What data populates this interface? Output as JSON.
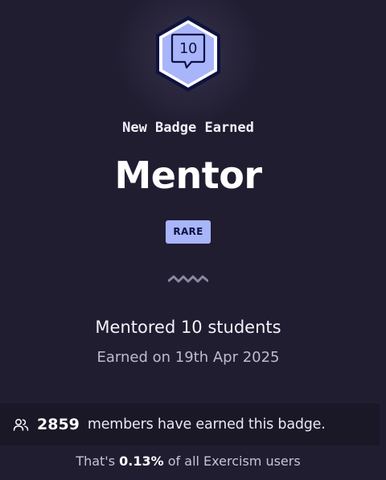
{
  "badge": {
    "name": "Mentor",
    "count_label": "10",
    "icon": "chat-bubble-icon",
    "rarity": "RARE",
    "description": "Mentored 10 students",
    "earned": "Earned on 19th Apr 2025"
  },
  "header": {
    "kicker": "New Badge Earned"
  },
  "stats": {
    "members_icon": "users-icon",
    "members_count": "2859",
    "members_text": "members have earned this badge.",
    "percentage_prefix": "That's",
    "percentage_value": "0.13%",
    "percentage_suffix": "of all Exercism users"
  },
  "colors": {
    "background": "#211d31",
    "badge_fill": "#a9b5fb",
    "badge_border": "#0d1240",
    "rarity_bg": "#a9b5fb",
    "stats_bar_bg": "#1a1727"
  }
}
